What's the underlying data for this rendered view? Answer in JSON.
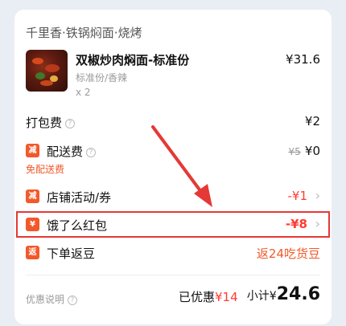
{
  "shop": {
    "name": "千里香·铁锅焖面·烧烤"
  },
  "item": {
    "name": "双椒炒肉焖面-标准份",
    "price": "¥31.6",
    "spec": "标准份/香辣",
    "qty": "x 2"
  },
  "packing": {
    "label": "打包费",
    "value": "¥2"
  },
  "delivery": {
    "badge": "减",
    "label": "配送费",
    "original": "¥5",
    "value": "¥0",
    "note": "免配送费"
  },
  "store_promo": {
    "badge": "减",
    "label": "店铺活动/券",
    "value": "-¥1"
  },
  "red_packet": {
    "badge": "¥",
    "label": "饿了么红包",
    "value": "-¥8"
  },
  "rebate": {
    "badge": "返",
    "label": "下单返豆",
    "value": "返24吃货豆"
  },
  "footer": {
    "note": "优惠说明",
    "saved_label": "已优惠",
    "saved_value": "¥14",
    "subtotal_label": "小计",
    "currency": "¥",
    "subtotal_value": "24.6"
  },
  "colors": {
    "accent_red": "#ff3b30",
    "accent_orange": "#f2592a",
    "highlight_box": "#e53935",
    "annotation_arrow": "#e53935"
  }
}
